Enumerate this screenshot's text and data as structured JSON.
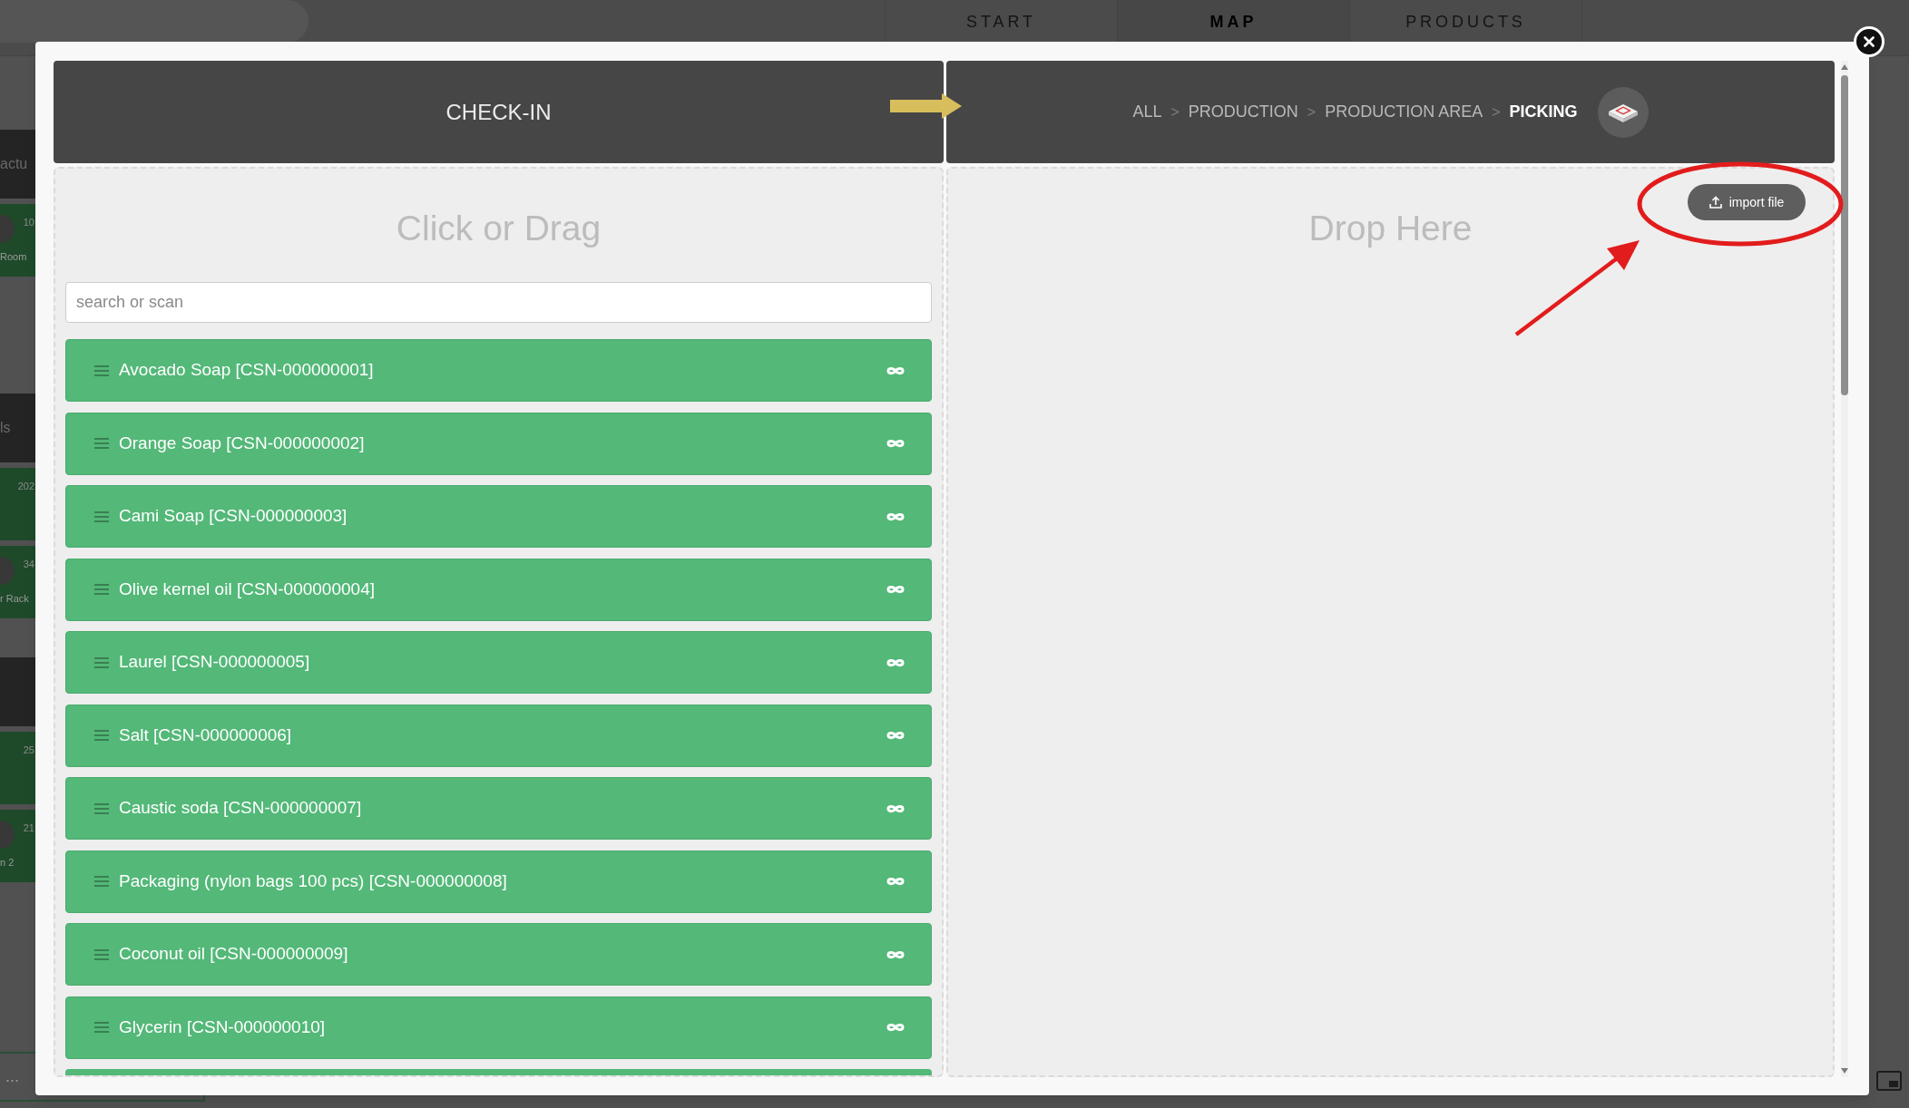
{
  "top_bar": {
    "tabs": [
      {
        "label": "START",
        "selected": false
      },
      {
        "label": "MAP",
        "selected": true
      },
      {
        "label": "PRODUCTS",
        "selected": false
      }
    ]
  },
  "background_groups": [
    {
      "title": "actu",
      "cards": [
        {
          "kind": "photo",
          "count": "10",
          "label": "Room"
        }
      ]
    },
    {
      "title": "ls",
      "cards": [
        {
          "kind": "plain",
          "count": "202"
        },
        {
          "kind": "photo",
          "count": "34",
          "label": "r Rack"
        }
      ]
    },
    {
      "cards": [
        {
          "kind": "plain",
          "count": "25"
        },
        {
          "kind": "photo",
          "count": "21",
          "label": "n 2"
        }
      ]
    }
  ],
  "background_footer": {
    "label": "..."
  },
  "modal": {
    "source_panel": {
      "title": "CHECK-IN",
      "heading": "Click or Drag",
      "search": {
        "placeholder": "search or scan"
      },
      "items": [
        {
          "label": "Avocado Soap [CSN-000000001]"
        },
        {
          "label": "Orange Soap [CSN-000000002]"
        },
        {
          "label": "Cami Soap [CSN-000000003]"
        },
        {
          "label": "Olive kernel oil [CSN-000000004]"
        },
        {
          "label": "Laurel [CSN-000000005]"
        },
        {
          "label": "Salt [CSN-000000006]"
        },
        {
          "label": "Caustic soda [CSN-000000007]"
        },
        {
          "label": "Packaging (nylon bags 100 pcs) [CSN-000000008]"
        },
        {
          "label": "Coconut oil [CSN-000000009]"
        },
        {
          "label": "Glycerin [CSN-000000010]"
        }
      ],
      "more_below": true
    },
    "target_panel": {
      "breadcrumb": [
        {
          "kind": "link",
          "label": "ALL",
          "current": false
        },
        {
          "kind": "separator",
          "label": ">"
        },
        {
          "kind": "link",
          "label": "PRODUCTION",
          "current": false
        },
        {
          "kind": "separator",
          "label": ">"
        },
        {
          "kind": "link",
          "label": "PRODUCTION AREA",
          "current": false
        },
        {
          "kind": "separator",
          "label": ">"
        },
        {
          "kind": "link",
          "label": "PICKING",
          "current": true
        }
      ],
      "heading": "Drop Here",
      "import_button": {
        "label": "import file"
      }
    }
  }
}
